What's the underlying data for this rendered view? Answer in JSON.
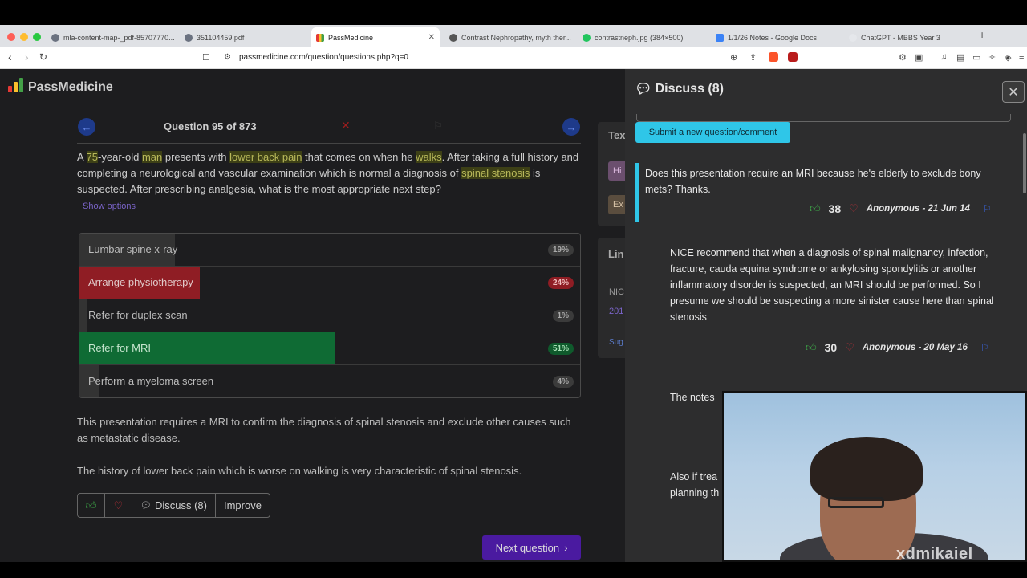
{
  "browser": {
    "tabs": [
      {
        "title": "mla-content-map-_pdf-85707770...",
        "icon_color": "#6b7280"
      },
      {
        "title": "351104459.pdf",
        "icon_color": "#6b7280"
      },
      {
        "title": "PassMedicine",
        "icon_color": "#e53935",
        "active": true
      },
      {
        "title": "Contrast Nephropathy, myth ther...",
        "icon_color": "#555"
      },
      {
        "title": "contrastneph.jpg (384×500)",
        "icon_color": "#22c55e"
      },
      {
        "title": "1/1/26 Notes - Google Docs",
        "icon_color": "#3b82f6"
      },
      {
        "title": "ChatGPT - MBBS Year 3",
        "icon_color": "#e5e7eb"
      }
    ],
    "url": "passmedicine.com/question/questions.php?q=0"
  },
  "header": {
    "logo_text": "PassMedicine"
  },
  "question": {
    "counter": "Question 95 of 873",
    "stem_parts": [
      {
        "text": "A ",
        "hl": false
      },
      {
        "text": "75",
        "hl": true
      },
      {
        "text": "-year-old ",
        "hl": false
      },
      {
        "text": "man",
        "hl": true
      },
      {
        "text": " presents with ",
        "hl": false
      },
      {
        "text": "lower back pain",
        "hl": true
      },
      {
        "text": " that comes on when he ",
        "hl": false
      },
      {
        "text": "walks",
        "hl": true
      },
      {
        "text": ". After taking a full history and completing a neurological and vascular examination which is normal a diagnosis of ",
        "hl": false
      },
      {
        "text": "spinal stenosis",
        "hl": true
      },
      {
        "text": " is suspected. After prescribing analgesia, what is the most appropriate next step?",
        "hl": false
      }
    ],
    "show_options": "Show options",
    "options": [
      {
        "label": "Lumbar spine x-ray",
        "pct": "19%",
        "pct_value": 19,
        "state": "neutral"
      },
      {
        "label": "Arrange physiotherapy",
        "pct": "24%",
        "pct_value": 24,
        "state": "wrong"
      },
      {
        "label": "Refer for duplex scan",
        "pct": "1%",
        "pct_value": 1,
        "state": "neutral"
      },
      {
        "label": "Refer for MRI",
        "pct": "51%",
        "pct_value": 51,
        "state": "correct"
      },
      {
        "label": "Perform a myeloma screen",
        "pct": "4%",
        "pct_value": 4,
        "state": "neutral"
      }
    ],
    "explanation": [
      "This presentation requires a MRI to confirm the diagnosis of spinal stenosis and exclude other causes such as metastatic disease.",
      "The history of lower back pain which is worse on walking is very characteristic of spinal stenosis."
    ],
    "actions": {
      "discuss": "Discuss (8)",
      "improve": "Improve"
    },
    "next": "Next question"
  },
  "sidebar_cards": {
    "text_heading": "Tex",
    "btn1": "Hi",
    "btn2": "Ex",
    "links_heading": "Lin",
    "link1": "NIC",
    "link2": "201",
    "suggest": "Sug"
  },
  "discuss": {
    "title": "Discuss (8)",
    "submit": "Submit a new question/comment",
    "comments": [
      {
        "text": "Does this presentation require an MRI because he's elderly to exclude bony mets? Thanks.",
        "votes": "38",
        "author": "Anonymous - 21 Jun 14"
      },
      {
        "text": "NICE recommend that when a diagnosis of spinal malignancy, infection, fracture, cauda equina syndrome or ankylosing spondylitis or another inflammatory disorder is suspected, an MRI should be performed. So I presume we should be suspecting a more sinister cause here than spinal stenosis",
        "votes": "30",
        "author": "Anonymous - 20 May 16"
      },
      {
        "text": "The notes"
      },
      {
        "text": "Also if trea planning th"
      }
    ]
  },
  "webcam": {
    "watermark": "xdmikaiel"
  },
  "colors": {
    "correct": "#0f6b34",
    "wrong": "#8f1d24",
    "neutral": "#333333",
    "accent": "#2fc6e8"
  }
}
